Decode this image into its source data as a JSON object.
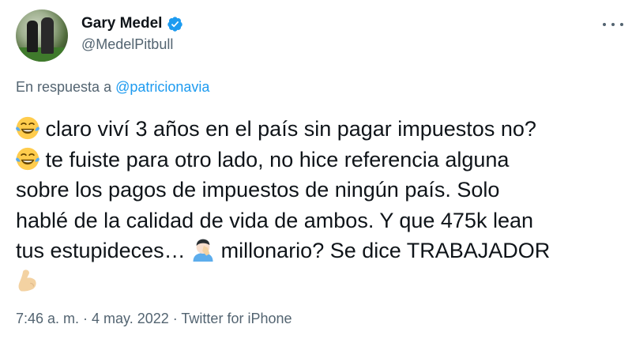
{
  "header": {
    "name": "Gary Medel",
    "handle": "@MedelPitbull"
  },
  "reply": {
    "prefix": "En respuesta a",
    "mention": "@patricionavia"
  },
  "tweet": {
    "line1": "claro viví 3 años en el país sin pagar impuestos no?",
    "line2": "te fuiste para otro lado, no hice referencia alguna",
    "line3": "sobre los pagos de impuestos de ningún país. Solo",
    "line4": "hablé de la calidad de vida de ambos. Y que 475k lean",
    "line5a": "tus estupideces…",
    "line5b": "millonario? Se dice TRABAJADOR",
    "emojis": [
      "face-with-tears-of-joy",
      "face-with-tears-of-joy",
      "man-facepalming",
      "flexed-biceps"
    ]
  },
  "meta": {
    "text": "7:46 a. m. · 4 may. 2022 · Twitter for iPhone"
  },
  "colors": {
    "link": "#1d9bf0",
    "secondary_text": "#536471",
    "primary_text": "#0f1419",
    "verified": "#1d9bf0"
  }
}
